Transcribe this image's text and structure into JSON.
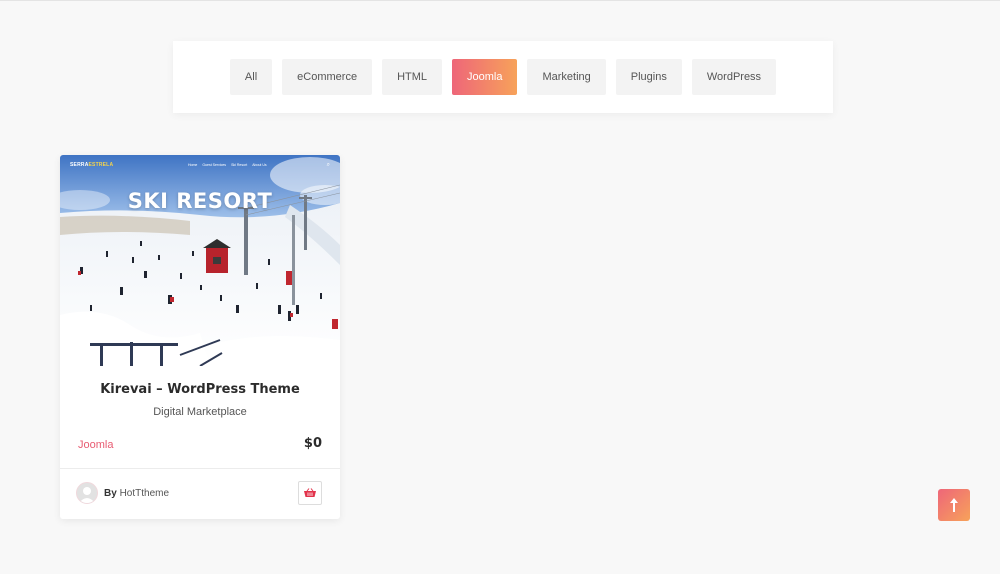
{
  "filters": [
    {
      "label": "All",
      "active": false
    },
    {
      "label": "eCommerce",
      "active": false
    },
    {
      "label": "HTML",
      "active": false
    },
    {
      "label": "Joomla",
      "active": true
    },
    {
      "label": "Marketing",
      "active": false
    },
    {
      "label": "Plugins",
      "active": false
    },
    {
      "label": "WordPress",
      "active": false
    }
  ],
  "product": {
    "thumbnail": {
      "logo_main": "SERRA",
      "logo_highlight": "ESTRELA",
      "nav_links": [
        "Home",
        "Guest Services",
        "Ski Resort",
        "About Us"
      ],
      "headline": "SKI RESORT"
    },
    "title": "Kirevai – WordPress Theme",
    "subtitle": "Digital Marketplace",
    "category": "Joomla",
    "price": "$0",
    "author_prefix": "By",
    "author_name": "HotTtheme",
    "cart_icon": "cart-icon"
  },
  "icons": {
    "scroll_top": "arrow-up-icon",
    "avatar": "user-avatar-icon"
  },
  "colors": {
    "accent_start": "#ee6679",
    "accent_end": "#f7a25a",
    "category": "#e85c72"
  }
}
